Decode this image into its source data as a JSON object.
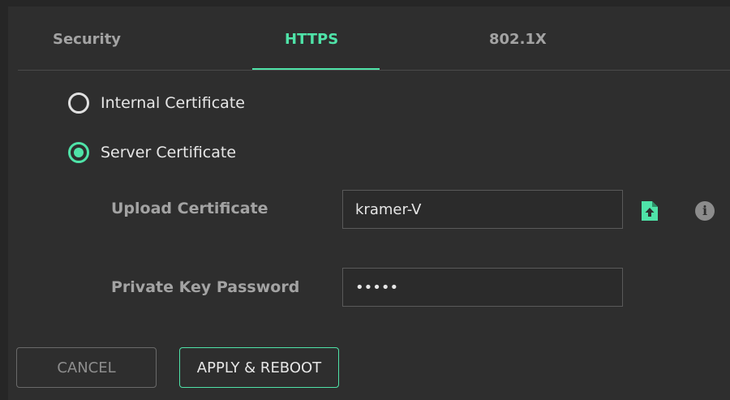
{
  "tabs": [
    {
      "label": "Security",
      "active": false
    },
    {
      "label": "HTTPS",
      "active": true
    },
    {
      "label": "802.1X",
      "active": false
    }
  ],
  "certificate": {
    "internal_label": "Internal Certificate",
    "internal_selected": false,
    "server_label": "Server Certificate",
    "server_selected": true
  },
  "fields": {
    "upload_label": "Upload Certificate",
    "upload_value": "kramer-V",
    "password_label": "Private Key Password",
    "password_value": "•••••"
  },
  "icons": {
    "upload": "file-upload-icon",
    "info": "info-icon",
    "info_glyph": "i"
  },
  "buttons": {
    "cancel_label": "CANCEL",
    "apply_label": "APPLY & REBOOT"
  },
  "colors": {
    "accent": "#4fe3a8",
    "background": "#2e2e2e",
    "text_muted": "#a3a3a3",
    "text": "#e6e6e6"
  }
}
